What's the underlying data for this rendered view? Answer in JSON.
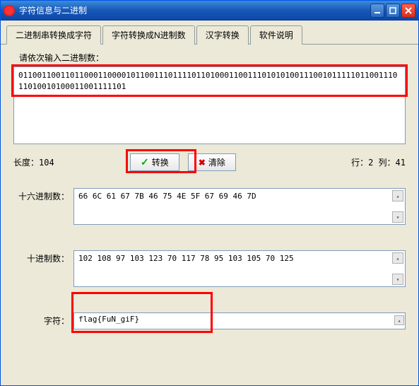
{
  "window": {
    "title": "字符信息与二进制"
  },
  "tabs": {
    "items": [
      {
        "label": "二进制串转换成字符"
      },
      {
        "label": "字符转换成N进制数"
      },
      {
        "label": "汉字转换"
      },
      {
        "label": "软件说明"
      }
    ]
  },
  "prompt": "请依次输入二进制数：",
  "binary_value": "01100110011011000110000101100111011110110100011001110101010011100101111101100111011010010100011001111101",
  "length_label": "长度：",
  "length_value": "104",
  "rowcol": "行：2  列：41",
  "buttons": {
    "convert": "转换",
    "clear": "清除"
  },
  "outputs": {
    "hex_label": "十六进制数：",
    "hex_value": "66 6C 61 67 7B 46 75 4E 5F 67 69 46 7D",
    "dec_label": "十进制数：",
    "dec_value": "102 108 97 103 123 70 117 78 95 103 105 70 125",
    "char_label": "字符：",
    "char_value": "flag{FuN_giF}"
  }
}
